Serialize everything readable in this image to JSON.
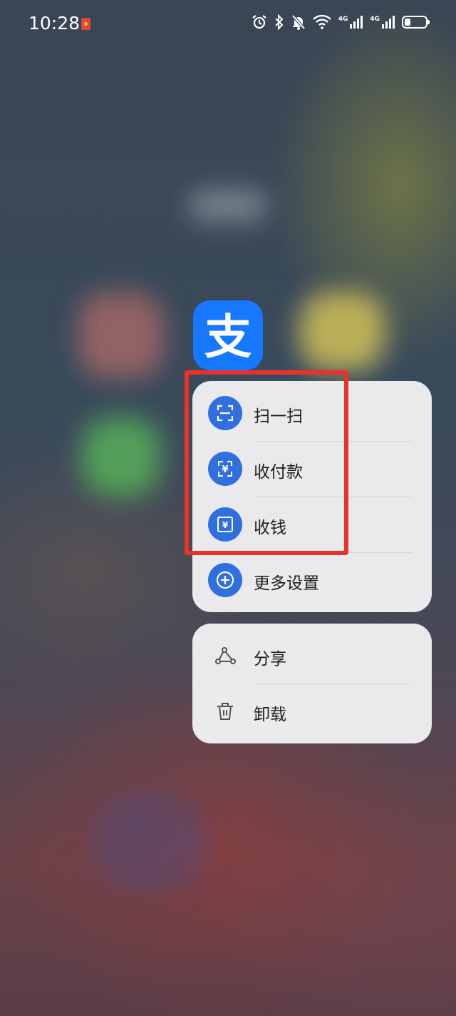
{
  "status_bar": {
    "time": "10:28",
    "signal_1_label": "4G",
    "signal_2_label": "4G",
    "icons": [
      "notification-redpacket-icon",
      "alarm-icon",
      "bluetooth-icon",
      "mute-bell-icon",
      "wifi-icon",
      "signal-4g-icon",
      "signal-4g-icon",
      "battery-icon"
    ]
  },
  "app": {
    "icon_glyph": "支",
    "brand_color": "#1677ff"
  },
  "menu_primary": {
    "items": [
      {
        "label": "扫一扫",
        "icon": "scan-icon"
      },
      {
        "label": "收付款",
        "icon": "pay-receive-icon"
      },
      {
        "label": "收钱",
        "icon": "collect-money-icon"
      },
      {
        "label": "更多设置",
        "icon": "plus-circle-icon"
      }
    ]
  },
  "menu_secondary": {
    "items": [
      {
        "label": "分享",
        "icon": "share-icon"
      },
      {
        "label": "卸载",
        "icon": "trash-icon"
      }
    ]
  },
  "annotation": {
    "highlight_color": "#e8322a"
  }
}
